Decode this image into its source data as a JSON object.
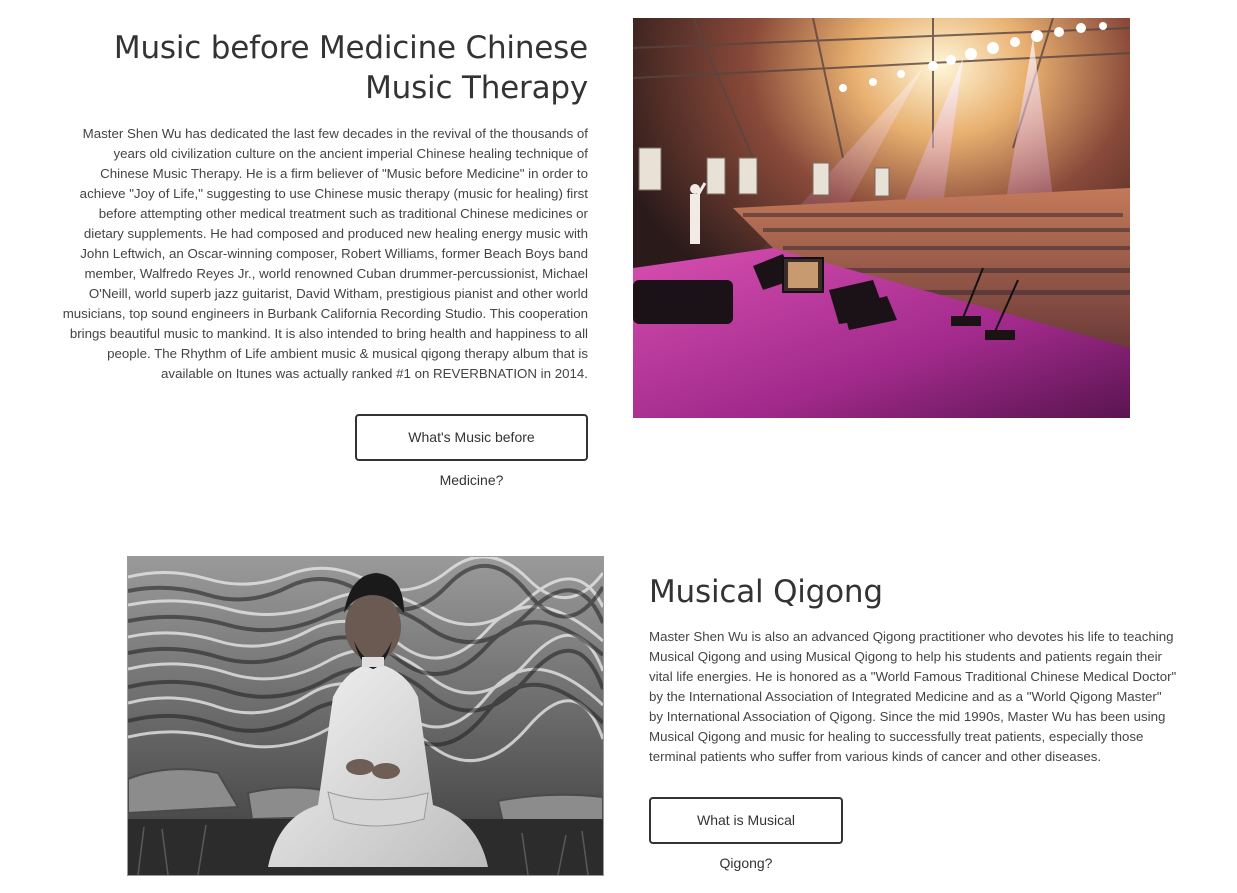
{
  "music_section": {
    "title": "Music before Medicine Chinese Music Therapy",
    "body": "Master Shen Wu has dedicated the last few decades in the revival of the thousands of years old civilization culture on the ancient imperial Chinese healing technique of Chinese Music Therapy. He is a firm believer of \"Music before Medicine\" in order to achieve \"Joy of Life,\" suggesting to use Chinese music therapy (music for healing) first before attempting other medical treatment such as traditional Chinese medicines or dietary supplements. He had composed and produced new healing energy music with John Leftwich, an Oscar-winning composer, Robert Williams, former Beach Boys band member, Walfredo Reyes Jr., world renowned Cuban drummer-percussionist, Michael O'Neill, world superb jazz guitarist, David Witham, prestigious pianist and other world musicians, top sound engineers in Burbank California Recording Studio. This cooperation brings beautiful music to mankind. It is also intended to bring health and happiness to all people. The Rhythm of Life ambient music & musical qigong therapy album that is available on Itunes was actually ranked #1 on REVERBNATION in 2014.",
    "button_label": "What's Music before Medicine?"
  },
  "qigong_section": {
    "title": "Musical Qigong",
    "body": "Master Shen Wu is also an advanced Qigong practitioner who devotes his life to teaching Musical Qigong and using Musical Qigong to help his students and patients regain their vital life energies. He is honored as a \"World Famous Traditional Chinese Medical Doctor\" by the International Association of Integrated Medicine and as a \"World Qigong Master\" by International Association of Qigong. Since the mid 1990s, Master Wu has been using Musical Qigong and music for healing to successfully treat patients, especially those terminal patients who suffer from various kinds of cancer and other diseases.",
    "button_label": "What is Musical Qigong?"
  },
  "images": {
    "concert": "concert-stage-photo",
    "meditation": "meditating-master-photo"
  }
}
